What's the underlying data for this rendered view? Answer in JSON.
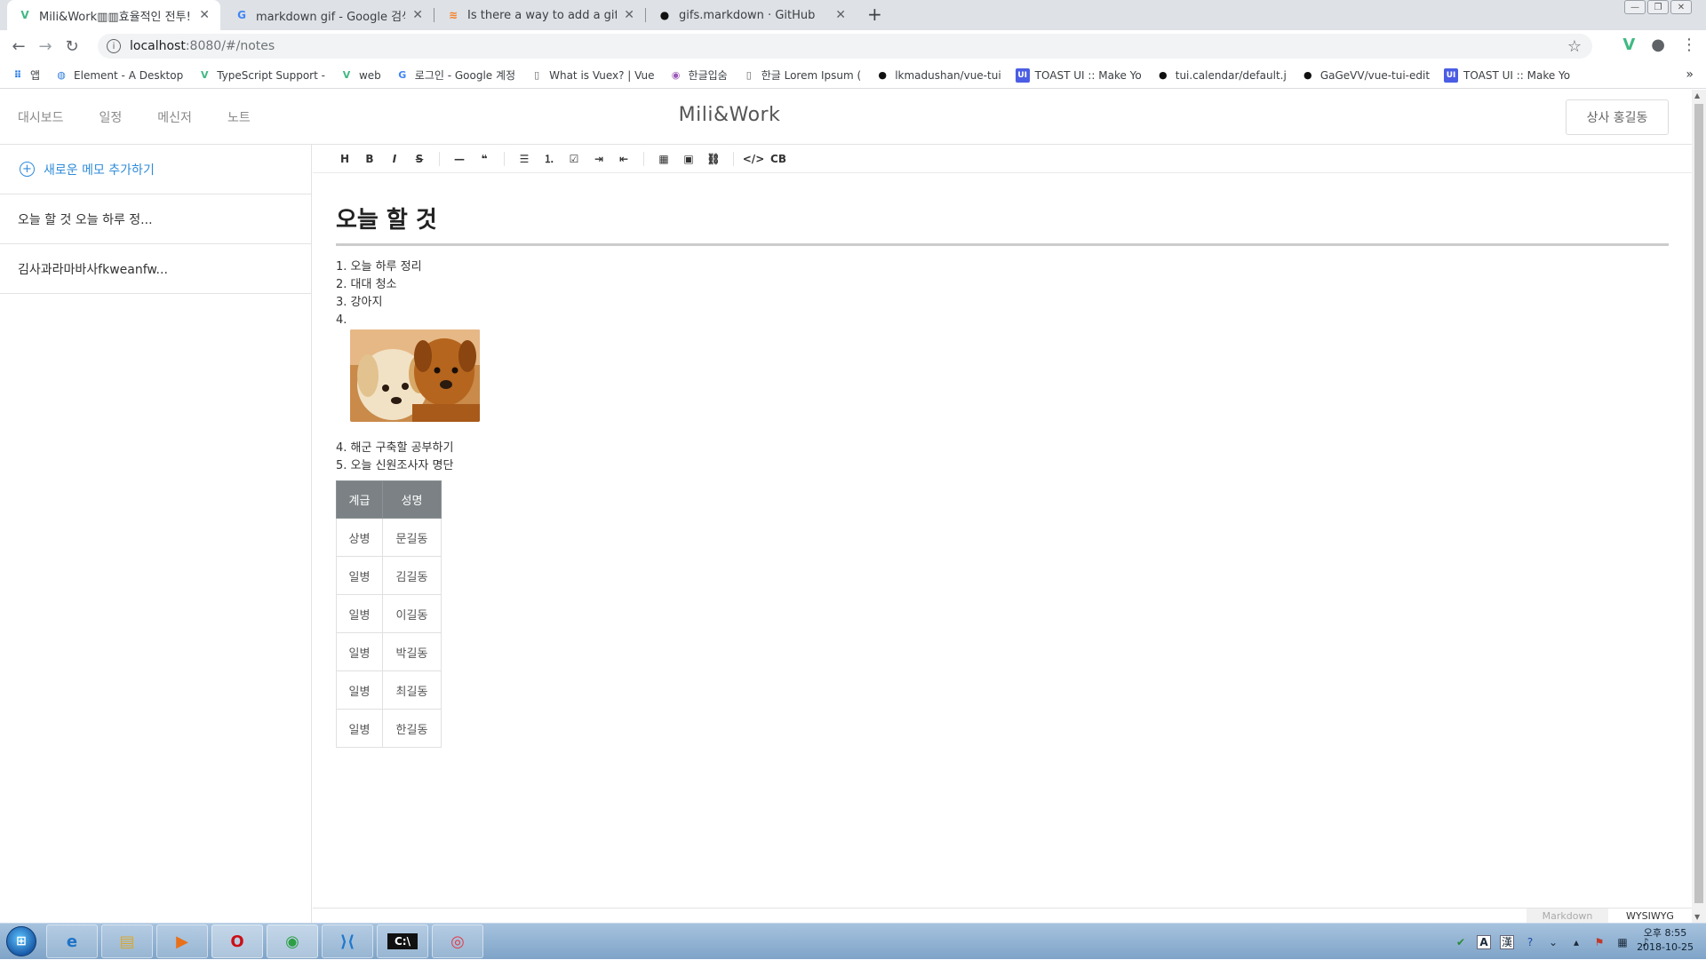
{
  "browser": {
    "tabs": [
      {
        "title": "Mili&Work▥▥효율적인 전투!",
        "icon": "vue-icon",
        "active": true
      },
      {
        "title": "markdown gif - Google 검색",
        "icon": "google-icon",
        "active": false
      },
      {
        "title": "Is there a way to add a gif to a",
        "icon": "stackoverflow-icon",
        "active": false
      },
      {
        "title": "gifs.markdown · GitHub",
        "icon": "github-icon",
        "active": false
      }
    ],
    "url_host": "localhost",
    "url_path": ":8080/#/notes",
    "bookmarks": [
      {
        "label": "앱",
        "icon": "apps-grid-icon"
      },
      {
        "label": "Element - A Desktop",
        "icon": "element-icon"
      },
      {
        "label": "TypeScript Support -",
        "icon": "vue-icon"
      },
      {
        "label": "web",
        "icon": "vue-icon"
      },
      {
        "label": "로그인 - Google 계정",
        "icon": "google-icon"
      },
      {
        "label": "What is Vuex? | Vue",
        "icon": "page-icon"
      },
      {
        "label": "한글입숨",
        "icon": "hangul-icon"
      },
      {
        "label": "한글 Lorem Ipsum (",
        "icon": "page-icon"
      },
      {
        "label": "lkmadushan/vue-tui",
        "icon": "github-icon"
      },
      {
        "label": "TOAST UI :: Make Yo",
        "icon": "toast-ui-icon"
      },
      {
        "label": "tui.calendar/default.j",
        "icon": "github-icon"
      },
      {
        "label": "GaGeVV/vue-tui-edit",
        "icon": "github-icon"
      },
      {
        "label": "TOAST UI :: Make Yo",
        "icon": "toast-ui-icon"
      }
    ]
  },
  "app": {
    "nav": [
      "대시보드",
      "일정",
      "메신저",
      "노트"
    ],
    "brand": "Mili&Work",
    "user_button": "상사 홍길동",
    "add_memo": "새로운 메모 추가하기",
    "memos": [
      "오늘 할 것 오늘 하루 정...",
      "김사과라마바사fkweanfw..."
    ]
  },
  "editor": {
    "toolbar": [
      "H",
      "B",
      "I",
      "S",
      "—",
      "❝",
      "☰",
      "⒈",
      "☑",
      "⇥",
      "⇤",
      "▦",
      "▣",
      "⛓",
      "</>",
      "CB"
    ],
    "heading": "오늘 할 것",
    "list": [
      "1. 오늘 하루 정리",
      "2. 대대 청소",
      "3. 강아지",
      "4."
    ],
    "lines": [
      "4. 해군 구축할 공부하기",
      "5. 오늘 신원조사자 명단"
    ],
    "table": {
      "headers": [
        "계급",
        "성명"
      ],
      "rows": [
        [
          "상병",
          "문길동"
        ],
        [
          "일병",
          "김길동"
        ],
        [
          "일병",
          "이길동"
        ],
        [
          "일병",
          "박길동"
        ],
        [
          "일병",
          "최길동"
        ],
        [
          "일병",
          "한길동"
        ]
      ]
    },
    "modes": {
      "markdown": "Markdown",
      "wysiwyg": "WYSIWYG"
    }
  },
  "taskbar": {
    "apps": [
      "ie-icon",
      "explorer-icon",
      "media-player-icon",
      "opera-icon",
      "chrome-icon",
      "vscode-icon",
      "cmd-icon",
      "screen-recorder-icon"
    ],
    "tray_ime": "A",
    "tray_hanja": "漢",
    "clock_time": "오후 8:55",
    "clock_date": "2018-10-25"
  }
}
